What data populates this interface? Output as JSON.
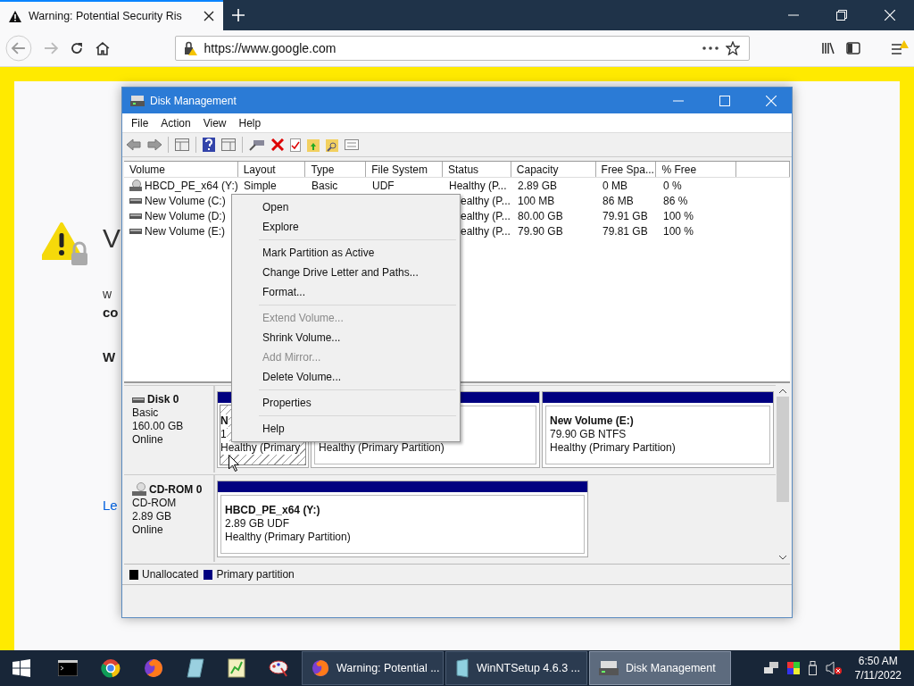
{
  "browser": {
    "tab": {
      "title": "Warning: Potential Security Ris"
    },
    "url": "https://www.google.com"
  },
  "page": {
    "fragments": [
      {
        "kind": "heading",
        "text": "V"
      },
      {
        "kind": "text",
        "text": "w"
      },
      {
        "kind": "bold",
        "text": "co"
      },
      {
        "kind": "bold",
        "text": "W"
      },
      {
        "kind": "link",
        "text": "Le"
      }
    ]
  },
  "window": {
    "title": "Disk Management",
    "menu": [
      "File",
      "Action",
      "View",
      "Help"
    ],
    "columns": [
      "Volume",
      "Layout",
      "Type",
      "File System",
      "Status",
      "Capacity",
      "Free Spa...",
      "% Free"
    ],
    "rows": [
      {
        "kind": "cdrom",
        "volume": "HBCD_PE_x64 (Y:)",
        "layout": "Simple",
        "type": "Basic",
        "file_system": "UDF",
        "status": "Healthy (P...",
        "capacity": "2.89 GB",
        "free_space": "0 MB",
        "percent_free": "0 %"
      },
      {
        "kind": "disk",
        "volume": "New Volume (C:)",
        "status": "ealthy (P...",
        "capacity": "100 MB",
        "free_space": "86 MB",
        "percent_free": "86 %"
      },
      {
        "kind": "disk",
        "volume": "New Volume (D:)",
        "status": "ealthy (P...",
        "capacity": "80.00 GB",
        "free_space": "79.91 GB",
        "percent_free": "100 %"
      },
      {
        "kind": "disk",
        "volume": "New Volume (E:)",
        "status": "ealthy (P...",
        "capacity": "79.90 GB",
        "free_space": "79.81 GB",
        "percent_free": "100 %"
      }
    ],
    "disks": [
      {
        "kind": "disk",
        "name": "Disk 0",
        "type": "Basic",
        "size": "160.00 GB",
        "state": "Online",
        "partitions": [
          {
            "name": "N",
            "size": "1",
            "status": "Healthy (Primary",
            "selected": true
          },
          {
            "status": "Healthy (Primary Partition)",
            "selected": false
          },
          {
            "name": "New Volume  (E:)",
            "size": "79.90 GB NTFS",
            "status": "Healthy (Primary Partition)",
            "selected": false
          }
        ]
      },
      {
        "kind": "cdrom",
        "name": "CD-ROM 0",
        "type": "CD-ROM",
        "size": "2.89 GB",
        "state": "Online",
        "partitions": [
          {
            "name": "HBCD_PE_x64  (Y:)",
            "size": "2.89 GB UDF",
            "status": "Healthy (Primary Partition)",
            "selected": false
          }
        ]
      }
    ],
    "legend": [
      {
        "label": "Unallocated",
        "color": "#000000"
      },
      {
        "label": "Primary partition",
        "color": "#000080"
      }
    ],
    "context_menu": [
      {
        "kind": "item",
        "label": "Open",
        "disabled": false
      },
      {
        "kind": "item",
        "label": "Explore",
        "disabled": false
      },
      {
        "kind": "separator"
      },
      {
        "kind": "item",
        "label": "Mark Partition as Active",
        "disabled": false
      },
      {
        "kind": "item",
        "label": "Change Drive Letter and Paths...",
        "disabled": false
      },
      {
        "kind": "item",
        "label": "Format...",
        "disabled": false
      },
      {
        "kind": "separator"
      },
      {
        "kind": "item",
        "label": "Extend Volume...",
        "disabled": true
      },
      {
        "kind": "item",
        "label": "Shrink Volume...",
        "disabled": false
      },
      {
        "kind": "item",
        "label": "Add Mirror...",
        "disabled": true
      },
      {
        "kind": "item",
        "label": "Delete Volume...",
        "disabled": false
      },
      {
        "kind": "separator"
      },
      {
        "kind": "item",
        "label": "Properties",
        "disabled": false
      },
      {
        "kind": "separator"
      },
      {
        "kind": "item",
        "label": "Help",
        "disabled": false
      }
    ]
  },
  "taskbar": {
    "tasks": [
      {
        "kind": "browser",
        "label": "Warning: Potential ...",
        "selected": false
      },
      {
        "kind": "setup",
        "label": "WinNTSetup 4.6.3  ...",
        "selected": false
      },
      {
        "kind": "disk",
        "label": "Disk Management",
        "selected": true
      }
    ],
    "time": "6:50 AM",
    "date": "7/11/2022"
  }
}
